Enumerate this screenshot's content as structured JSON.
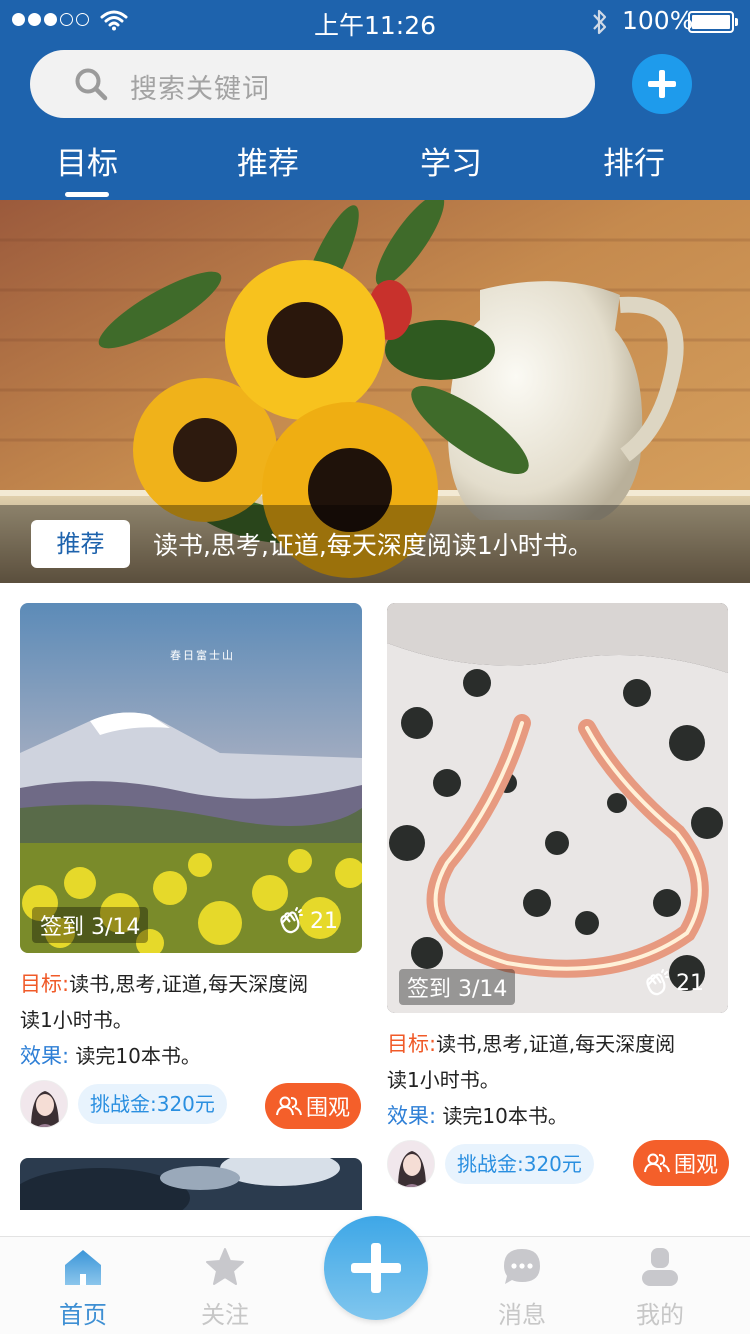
{
  "status_bar": {
    "time": "上午11:26",
    "battery": "100%"
  },
  "search": {
    "placeholder": "搜索关键词"
  },
  "tabs": [
    {
      "label": "目标",
      "active": true
    },
    {
      "label": "推荐",
      "active": false
    },
    {
      "label": "学习",
      "active": false
    },
    {
      "label": "排行",
      "active": false
    }
  ],
  "banner": {
    "tag": "推荐",
    "caption": "读书,思考,证道,每天深度阅读1小时书。"
  },
  "cards": [
    {
      "photo_caption": "春日富士山",
      "checkin": "签到 3/14",
      "likes": "21",
      "goal_label": "目标:",
      "goal_text_1": "读书,思考,证道,每天深度阅",
      "goal_text_2": "读1小时书。",
      "effect_label": "效果:",
      "effect_text": "读完10本书。",
      "stake": "挑战金:320元",
      "watch": "围观"
    },
    {
      "checkin": "签到 3/14",
      "likes": "21",
      "goal_label": "目标:",
      "goal_text_1": "读书,思考,证道,每天深度阅",
      "goal_text_2": "读1小时书。",
      "effect_label": "效果:",
      "effect_text": "读完10本书。",
      "stake": "挑战金:320元",
      "watch": "围观"
    }
  ],
  "tabbar": [
    {
      "label": "首页",
      "icon": "home-icon",
      "active": true
    },
    {
      "label": "关注",
      "icon": "star-icon",
      "active": false
    },
    {
      "label": "消息",
      "icon": "message-icon",
      "active": false
    },
    {
      "label": "我的",
      "icon": "user-icon",
      "active": false
    }
  ],
  "colors": {
    "header": "#1e63ad",
    "accent_orange": "#f45f2a",
    "accent_blue": "#1e9bec"
  }
}
